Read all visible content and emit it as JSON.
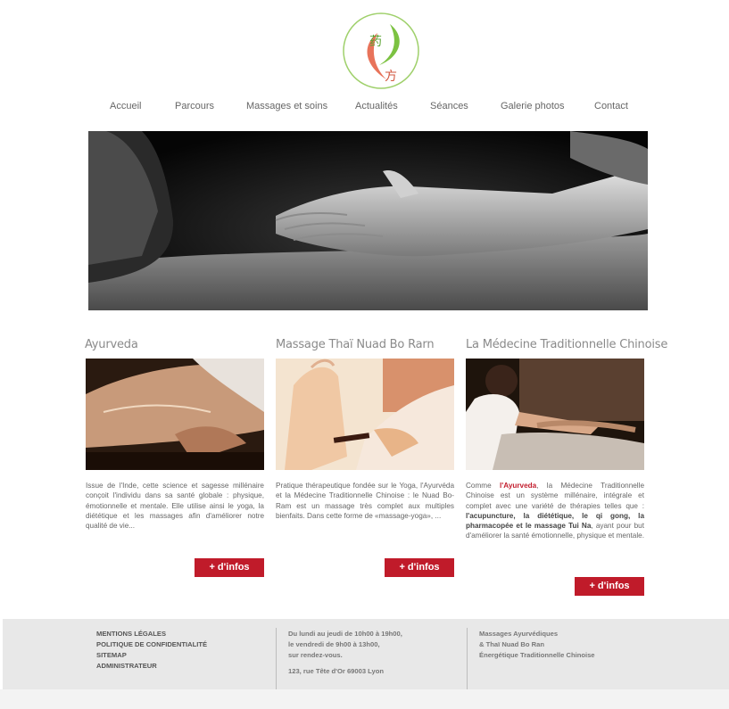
{
  "logo": {
    "glyph_top": "药",
    "glyph_bottom": "方"
  },
  "nav": {
    "items": [
      {
        "label": "Accueil"
      },
      {
        "label": "Parcours"
      },
      {
        "label": "Massages et soins"
      },
      {
        "label": "Actualités"
      },
      {
        "label": "Séances"
      },
      {
        "label": "Galerie photos"
      },
      {
        "label": "Contact"
      }
    ]
  },
  "columns": [
    {
      "title": "Ayurveda",
      "text": "Issue de l'Inde, cette science et sagesse millénaire conçoit l'individu dans sa santé globale : physique, émotionnelle et mentale. Elle utilise ainsi le yoga, la diététique et les massages afin d'améliorer notre qualité de vie...",
      "button": "+ d'infos"
    },
    {
      "title": "Massage Thaï Nuad Bo Rarn",
      "text": "Pratique thérapeutique fondée sur le Yoga, l'Ayurvéda et la Médecine Traditionnelle Chinoise : le Nuad Bo-Ram est un massage très complet aux multiples bienfaits. Dans cette forme de «massage-yoga», ...",
      "button": "+ d'infos"
    },
    {
      "title": "La Médecine Traditionnelle Chinoise",
      "text_a": "Comme ",
      "text_hl": "l'Ayurveda",
      "text_b": ", la Médecine Traditionnelle Chinoise est un système millénaire, intégrale et complet avec une variété de thérapies telles que : ",
      "text_bold": "l'acupuncture, la diététique, le qi gong, la pharmacopée et le massage Tui Na",
      "text_c": ", ayant pour but d'améliorer la santé émotionnelle, physique et mentale.",
      "button": "+ d'infos"
    }
  ],
  "footer": {
    "links": [
      "MENTIONS LÉGALES",
      "POLITIQUE DE CONFIDENTIALITÉ",
      "SITEMAP",
      "ADMINISTRATEUR"
    ],
    "hours": [
      "Du lundi au jeudi de 10h00 à 19h00,",
      "le vendredi de 9h00 à 13h00,",
      "sur rendez-vous."
    ],
    "address": "123, rue Tête d'Or 69003 Lyon",
    "services": [
      "Massages Ayurvédiques",
      "& Thaï Nuad Bo Ran",
      "Énergétique Traditionnelle Chinoise"
    ]
  },
  "colors": {
    "accent": "#c01b2a",
    "footer_bg": "#e8e8e8",
    "logo_green": "#7cc242",
    "logo_red": "#e8735a"
  }
}
